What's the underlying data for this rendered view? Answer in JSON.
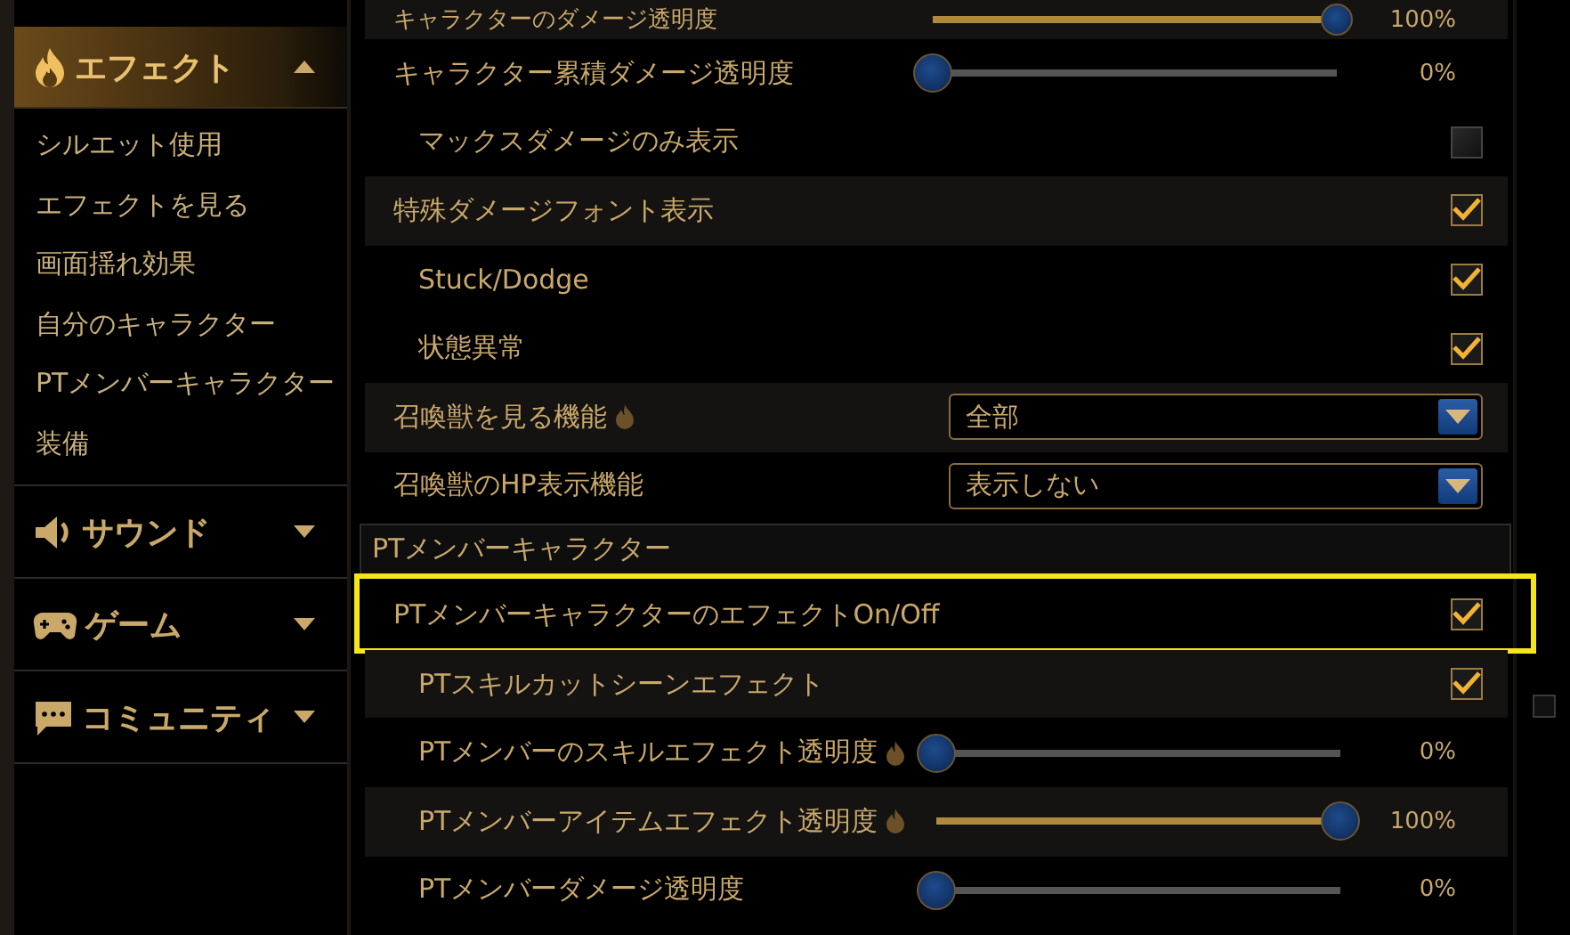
{
  "sidebar": {
    "categories": [
      {
        "label": "エフェクト",
        "expanded": true,
        "selected": true,
        "items": [
          {
            "label": "シルエット使用"
          },
          {
            "label": "エフェクトを見る"
          },
          {
            "label": "画面揺れ効果"
          },
          {
            "label": "自分のキャラクター"
          },
          {
            "label": "PTメンバーキャラクター"
          },
          {
            "label": "装備"
          }
        ]
      },
      {
        "label": "サウンド",
        "expanded": false,
        "selected": false
      },
      {
        "label": "ゲーム",
        "expanded": false,
        "selected": false
      },
      {
        "label": "コミュニティ",
        "expanded": false,
        "selected": false
      }
    ]
  },
  "settings": [
    {
      "kind": "slider",
      "label": "キャラクターのダメージ透明度",
      "level": 1,
      "reading": "100%",
      "shaded": true,
      "hot": false,
      "highlighted": false
    },
    {
      "kind": "slider",
      "label": "キャラクター累積ダメージ透明度",
      "level": 0,
      "reading": "0%",
      "shaded": false,
      "hot": false,
      "highlighted": false,
      "children": [
        {
          "kind": "checkbox",
          "label": "マックスダメージのみ表示",
          "checked": false,
          "disabled": true,
          "shaded": false,
          "hot": false,
          "highlighted": false
        }
      ]
    },
    {
      "kind": "checkbox",
      "label": "特殊ダメージフォント表示",
      "checked": true,
      "disabled": false,
      "shaded": true,
      "hot": false,
      "highlighted": false,
      "children": [
        {
          "kind": "checkbox",
          "label": "Stuck/Dodge",
          "checked": true,
          "disabled": false,
          "shaded": false,
          "hot": false,
          "highlighted": false
        },
        {
          "kind": "checkbox",
          "label": "状態異常",
          "checked": true,
          "disabled": false,
          "shaded": false,
          "hot": false,
          "highlighted": false
        }
      ]
    },
    {
      "kind": "select",
      "label": "召喚獣を見る機能",
      "value": "全部",
      "shaded": true,
      "hot": true,
      "highlighted": false
    },
    {
      "kind": "select",
      "label": "召喚獣のHP表示機能",
      "value": "表示しない",
      "shaded": false,
      "hot": false,
      "highlighted": false
    },
    {
      "kind": "header",
      "label": "PTメンバーキャラクター"
    },
    {
      "kind": "checkbox",
      "label": "PTメンバーキャラクターのエフェクトOn/Off",
      "checked": true,
      "disabled": false,
      "shaded": false,
      "hot": false,
      "highlighted": true,
      "children": [
        {
          "kind": "checkbox",
          "label": "PTスキルカットシーンエフェクト",
          "checked": true,
          "disabled": false,
          "shaded": true,
          "hot": false,
          "highlighted": false
        },
        {
          "kind": "slider",
          "label": "PTメンバーのスキルエフェクト透明度",
          "level": 0,
          "reading": "0%",
          "shaded": false,
          "hot": true,
          "highlighted": false
        },
        {
          "kind": "slider",
          "label": "PTメンバーアイテムエフェクト透明度",
          "level": 1,
          "reading": "100%",
          "shaded": true,
          "hot": true,
          "highlighted": false
        },
        {
          "kind": "slider",
          "label": "PTメンバーダメージ透明度",
          "level": 0,
          "reading": "0%",
          "shaded": false,
          "hot": false,
          "highlighted": false
        }
      ]
    }
  ]
}
